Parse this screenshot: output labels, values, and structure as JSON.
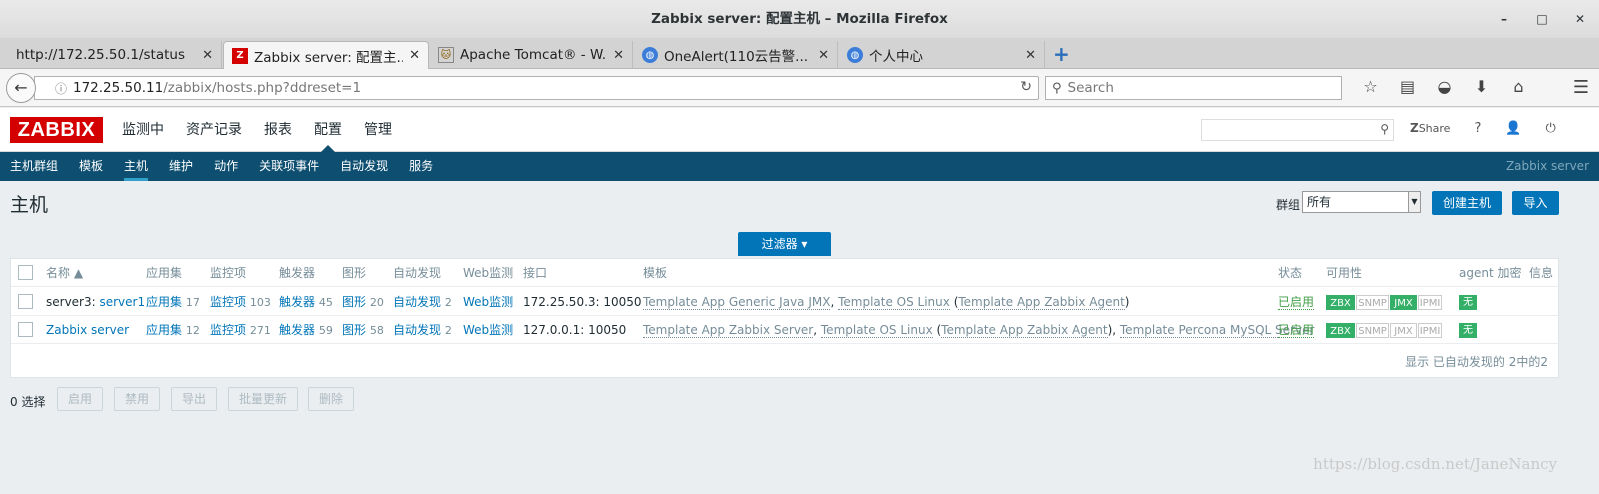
{
  "window": {
    "title": "Zabbix server: 配置主机 – Mozilla Firefox",
    "controls": [
      "–",
      "□",
      "✕"
    ]
  },
  "tabs": [
    {
      "title": "http://172.25.50.1/status",
      "favicon": "none"
    },
    {
      "title": "Zabbix server: 配置主...",
      "favicon": "zabbix-icon",
      "active": true
    },
    {
      "title": "Apache Tomcat® - W...",
      "favicon": "tomcat-icon"
    },
    {
      "title": "OneAlert(110云告警...",
      "favicon": "globe-icon"
    },
    {
      "title": "个人中心",
      "favicon": "globe-icon"
    }
  ],
  "urlbar": {
    "host": "172.25.50.11",
    "path": "/zabbix/hosts.php?ddreset=1"
  },
  "searchbar": {
    "placeholder": "Search"
  },
  "zabbix": {
    "logo": "ZABBIX",
    "top_menu": [
      "监测中",
      "资产记录",
      "报表",
      "配置",
      "管理"
    ],
    "top_menu_selected": "配置",
    "share_label": "Share",
    "help": "?",
    "sub_menu": [
      "主机群组",
      "模板",
      "主机",
      "维护",
      "动作",
      "关联项事件",
      "自动发现",
      "服务"
    ],
    "sub_menu_selected": "主机",
    "server_name": "Zabbix server"
  },
  "page": {
    "title": "主机",
    "group_label": "群组",
    "group_value": "所有",
    "create_button": "创建主机",
    "import_button": "导入",
    "filter_button": "过滤器 ▾"
  },
  "table": {
    "headers": {
      "name": "名称 ▲",
      "apps": "应用集",
      "items": "监控项",
      "triggers": "触发器",
      "graphs": "图形",
      "discovery": "自动发现",
      "web": "Web监测",
      "interface": "接口",
      "templates": "模板",
      "status": "状态",
      "availability": "可用性",
      "encryption": "agent 加密",
      "info": "信息"
    },
    "rows": [
      {
        "name_prefix": "server3: ",
        "name": "server1",
        "apps": "应用集",
        "apps_count": "17",
        "items": "监控项",
        "items_count": "103",
        "triggers": "触发器",
        "triggers_count": "45",
        "graphs": "图形",
        "graphs_count": "20",
        "discovery": "自动发现",
        "discovery_count": "2",
        "web": "Web监测",
        "interface": "172.25.50.3: 10050",
        "t1": "Template App Generic Java JMX",
        "sep1": ", ",
        "t2": "Template OS Linux",
        "sep2": " (",
        "t3": "Template App Zabbix Agent",
        "sep3": ")",
        "t4": "",
        "status": "已启用",
        "zbx": "ZBX",
        "snmp": "SNMP",
        "jmx": "JMX",
        "ipmi": "IPMI",
        "jmx_on": true,
        "encryption": "无"
      },
      {
        "name_prefix": "",
        "name": "Zabbix server",
        "apps": "应用集",
        "apps_count": "12",
        "items": "监控项",
        "items_count": "271",
        "triggers": "触发器",
        "triggers_count": "59",
        "graphs": "图形",
        "graphs_count": "58",
        "discovery": "自动发现",
        "discovery_count": "2",
        "web": "Web监测",
        "interface": "127.0.0.1: 10050",
        "t1": "Template App Zabbix Server",
        "sep1": ", ",
        "t2": "Template OS Linux",
        "sep2": " (",
        "t3": "Template App Zabbix Agent",
        "sep3": "), ",
        "t4": "Template Percona MySQL Server",
        "status": "已启用",
        "zbx": "ZBX",
        "snmp": "SNMP",
        "jmx": "JMX",
        "ipmi": "IPMI",
        "jmx_on": false,
        "encryption": "无"
      }
    ],
    "footer": "显示 已自动发现的 2中的2"
  },
  "actions": {
    "selected": "0 选择",
    "buttons": [
      "启用",
      "禁用",
      "导出",
      "批量更新",
      "删除"
    ]
  },
  "watermark": "https://blog.csdn.net/JaneNancy"
}
